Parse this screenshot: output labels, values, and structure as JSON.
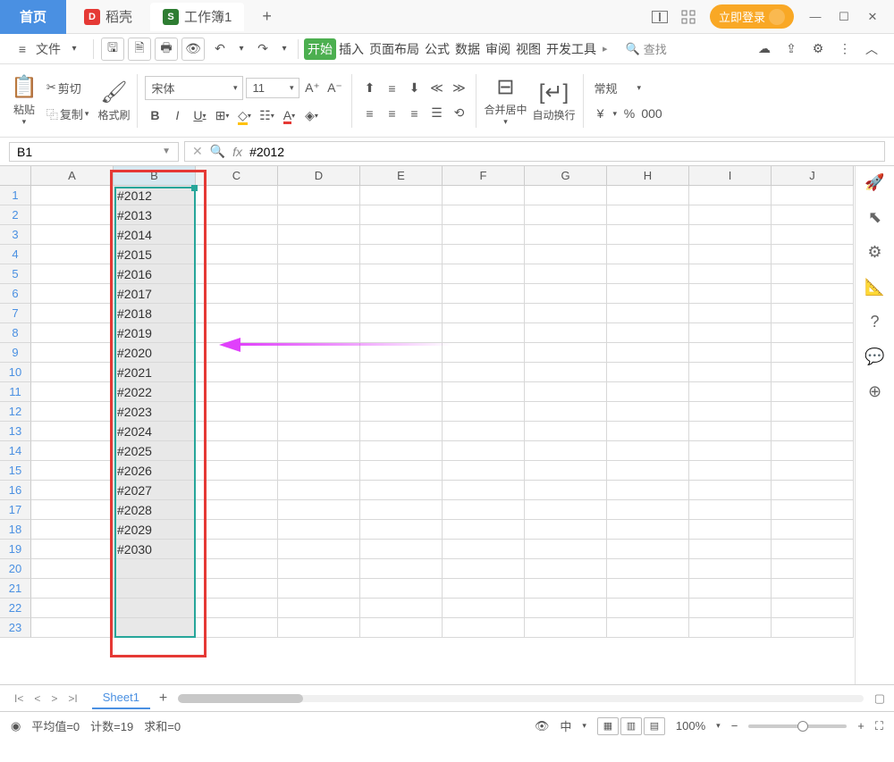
{
  "titlebar": {
    "home_tab": "首页",
    "doc1_label": "稻壳",
    "doc2_label": "工作簿1",
    "login": "立即登录"
  },
  "menubar": {
    "file": "文件",
    "tabs": [
      "开始",
      "插入",
      "页面布局",
      "公式",
      "数据",
      "审阅",
      "视图",
      "开发工具"
    ],
    "search_placeholder": "查找"
  },
  "ribbon": {
    "paste": "粘贴",
    "cut": "剪切",
    "copy": "复制",
    "format_painter": "格式刷",
    "font_name": "宋体",
    "font_size": "11",
    "merge_center": "合并居中",
    "wrap_text": "自动换行",
    "number_format": "常规",
    "currency": "¥",
    "percent": "%",
    "thousands": "000"
  },
  "formula_bar": {
    "cell_ref": "B1",
    "formula_text": "#2012"
  },
  "grid": {
    "columns": [
      "A",
      "B",
      "C",
      "D",
      "E",
      "F",
      "G",
      "H",
      "I",
      "J"
    ],
    "row_count": 23,
    "selected_column_index": 1,
    "data": {
      "B": [
        "#2012",
        "#2013",
        "#2014",
        "#2015",
        "#2016",
        "#2017",
        "#2018",
        "#2019",
        "#2020",
        "#2021",
        "#2022",
        "#2023",
        "#2024",
        "#2025",
        "#2026",
        "#2027",
        "#2028",
        "#2029",
        "#2030"
      ]
    }
  },
  "sheet": {
    "active": "Sheet1"
  },
  "status": {
    "avg_label": "平均值=0",
    "count_label": "计数=19",
    "sum_label": "求和=0",
    "zoom": "100%"
  }
}
